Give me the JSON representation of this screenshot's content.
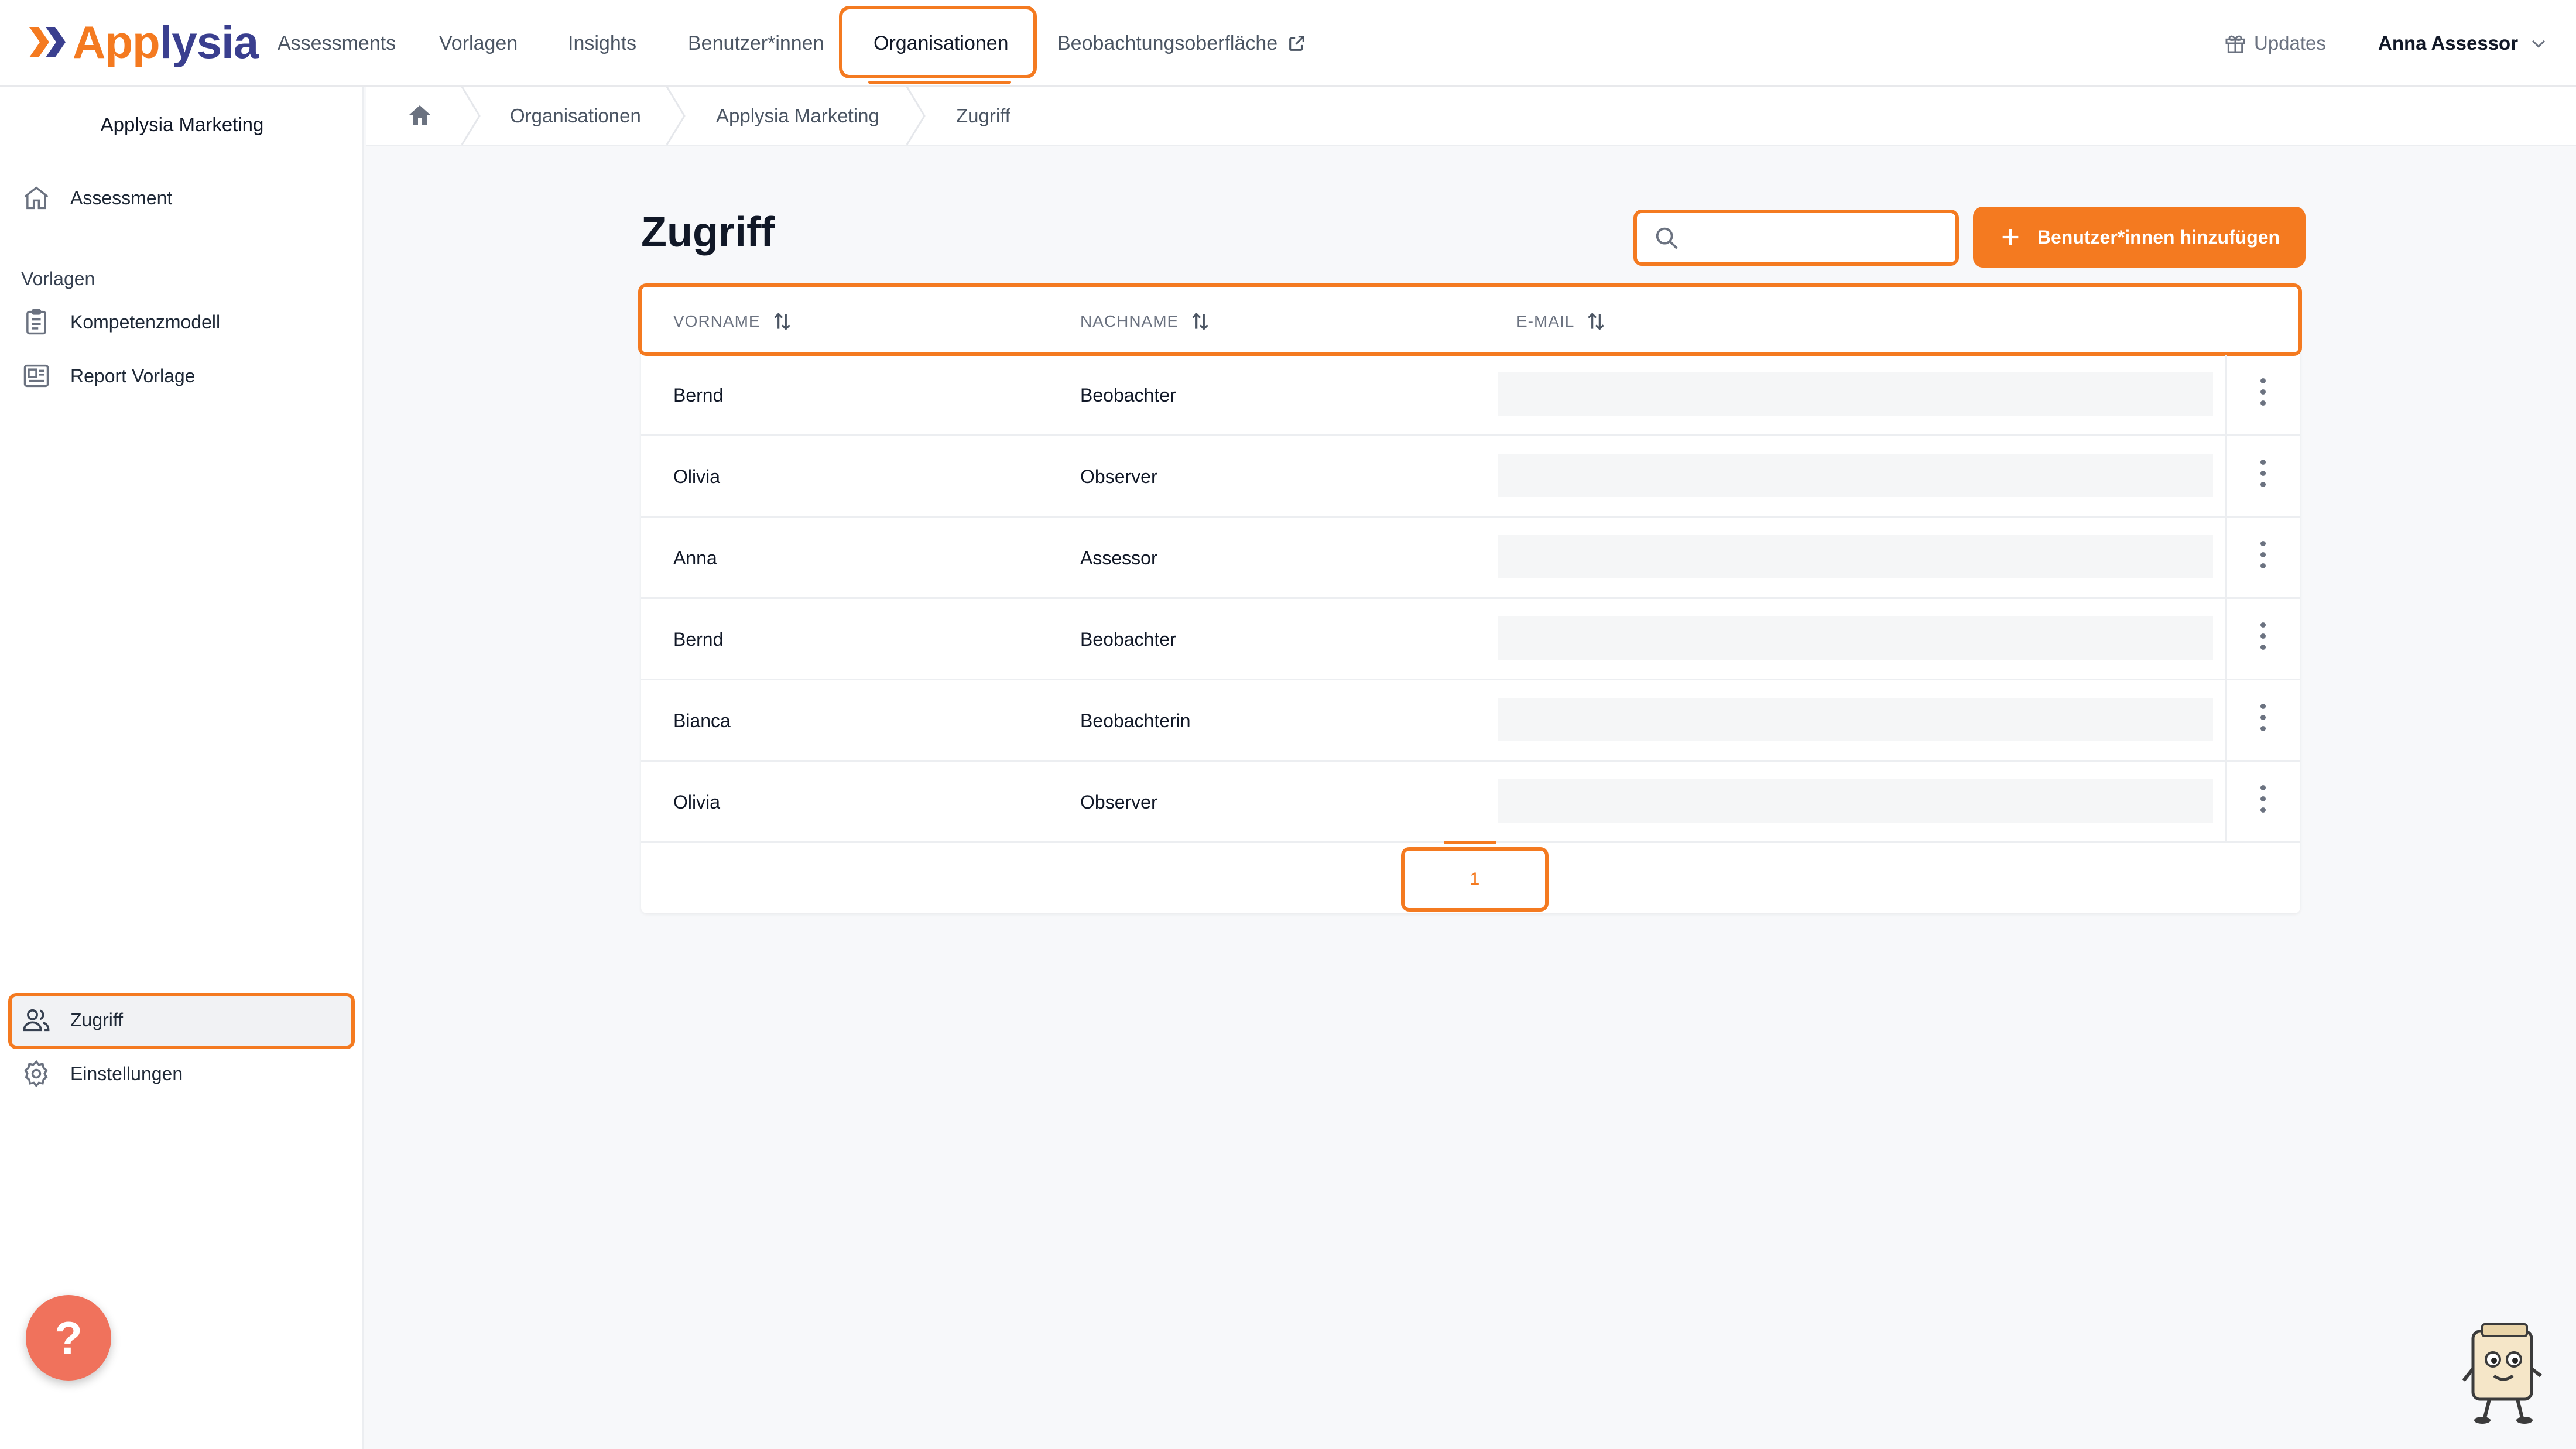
{
  "brand": {
    "name_a": "App",
    "name_b": "lysia",
    "accent": "#f47a20",
    "brand_dark": "#3a3f8f"
  },
  "nav": {
    "items": [
      "Assessments",
      "Vorlagen",
      "Insights",
      "Benutzer*innen",
      "Organisationen",
      "Beobachtungsoberfläche"
    ],
    "active": "Organisationen",
    "updates_label": "Updates",
    "user_name": "Anna Assessor"
  },
  "sidebar": {
    "org_name": "Applysia Marketing",
    "assessment_label": "Assessment",
    "section_vorlagen": "Vorlagen",
    "kompetenzmodell_label": "Kompetenzmodell",
    "report_vorlage_label": "Report Vorlage",
    "zugriff_label": "Zugriff",
    "einstellungen_label": "Einstellungen",
    "active": "Zugriff",
    "help_label": "?"
  },
  "breadcrumb": [
    "Organisationen",
    "Applysia Marketing",
    "Zugriff"
  ],
  "page": {
    "title": "Zugriff",
    "search_value": "",
    "add_button_label": "Benutzer*innen hinzufügen"
  },
  "table": {
    "headers": [
      "VORNAME",
      "NACHNAME",
      "E-MAIL"
    ],
    "rows": [
      {
        "vorname": "Bernd",
        "nachname": "Beobachter",
        "email": ""
      },
      {
        "vorname": "Olivia",
        "nachname": "Observer",
        "email": ""
      },
      {
        "vorname": "Anna",
        "nachname": "Assessor",
        "email": ""
      },
      {
        "vorname": "Bernd",
        "nachname": "Beobachter",
        "email": ""
      },
      {
        "vorname": "Bianca",
        "nachname": "Beobachterin",
        "email": ""
      },
      {
        "vorname": "Olivia",
        "nachname": "Observer",
        "email": ""
      }
    ]
  },
  "pagination": {
    "current_page": "1"
  }
}
